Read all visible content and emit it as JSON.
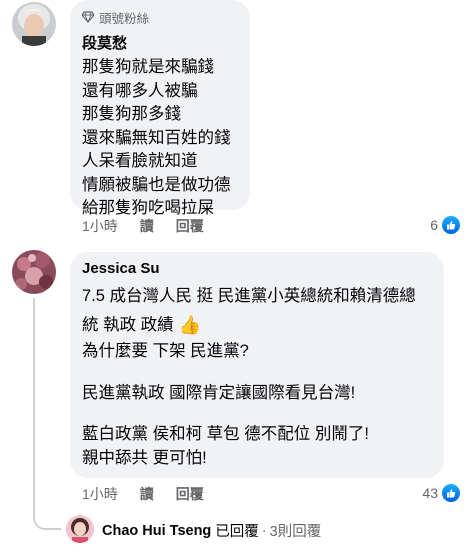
{
  "comments": [
    {
      "badge": "頭號粉絲",
      "author": "段莫愁",
      "lines": [
        "那隻狗就是來騙錢",
        "還有哪多人被騙",
        "那隻狗那多錢",
        "還來騙無知百姓的錢",
        "人呆看臉就知道",
        "情願被騙也是做功德",
        "給那隻狗吃喝拉屎"
      ],
      "time": "1小時",
      "read": "讀",
      "reply": "回覆",
      "reactions": "6"
    },
    {
      "author": "Jessica Su",
      "lines": [
        "7.5 成台灣人民 挺 民進黨小英總統和賴清德總",
        "統 執政 政績",
        "為什麼要 下架 民進黨?",
        "",
        "民進黨執政 國際肯定讓國際看見台灣!",
        "",
        "藍白政黨 侯和柯 草包 德不配位 別鬧了!",
        "親中舔共 更可怕!"
      ],
      "emoji": "👍",
      "time": "1小時",
      "read": "讀",
      "reply": "回覆",
      "reactions": "43"
    }
  ],
  "reply_summary": {
    "name": "Chao Hui Tseng",
    "status": "已回覆",
    "separator": "·",
    "count": "3則回覆"
  },
  "colors": {
    "bubble": "#f0f2f5",
    "secondary_text": "#65676b",
    "like_blue": "#1877f2"
  }
}
